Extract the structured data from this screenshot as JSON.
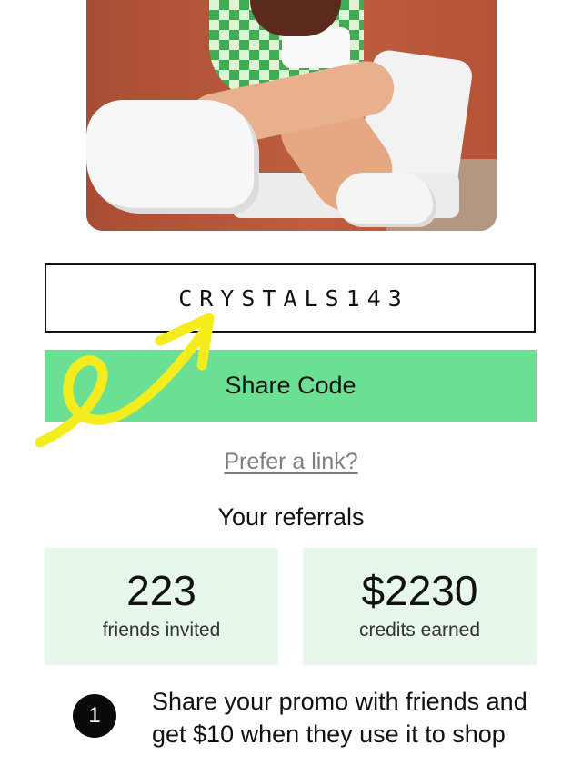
{
  "hero": {
    "icon": "promo-photo"
  },
  "promo": {
    "code": "CRYSTALS143",
    "share_button_label": "Share Code",
    "link_label": "Prefer a link?"
  },
  "referrals": {
    "title": "Your referrals",
    "stats": [
      {
        "value": "223",
        "label": "friends invited"
      },
      {
        "value": "$2230",
        "label": "credits earned"
      }
    ]
  },
  "steps": [
    {
      "number": "1",
      "text": "Share your promo with friends and get $10 when they use it to shop"
    }
  ],
  "colors": {
    "accent": "#6bdf93",
    "card_bg": "#e7f8ea",
    "annotation": "#f5ec1e"
  }
}
